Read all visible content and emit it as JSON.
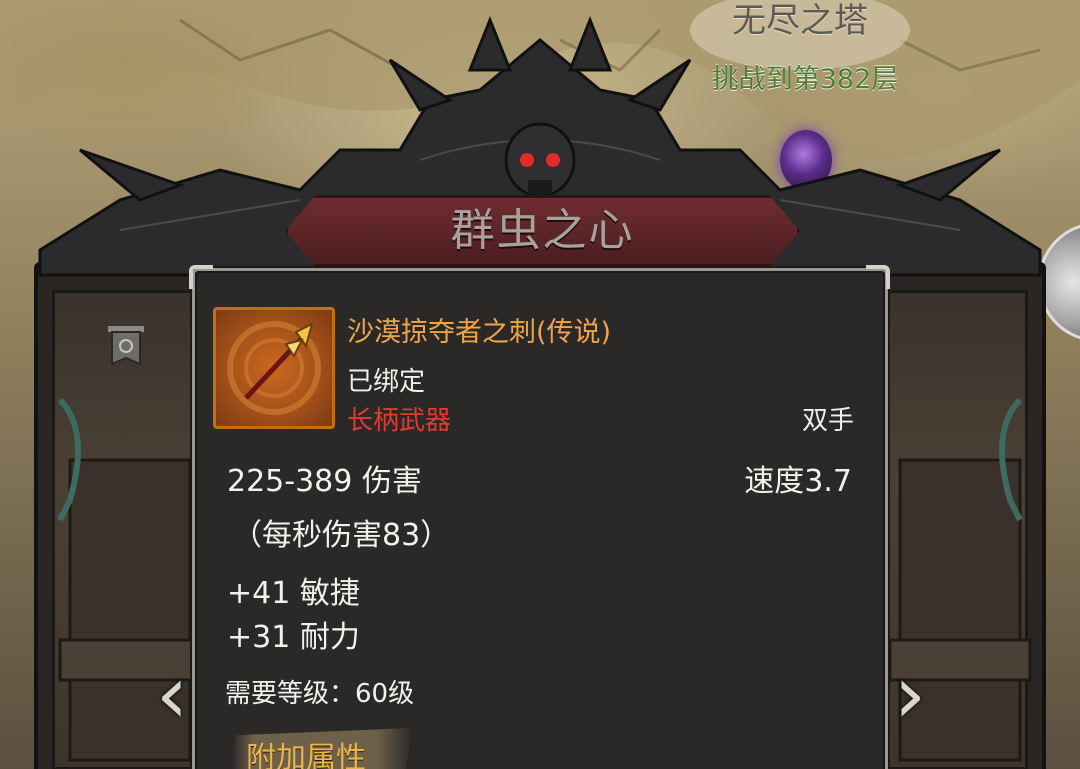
{
  "location": {
    "title": "无尽之塔",
    "subtitle": "挑战到第382层"
  },
  "header": {
    "title": "群虫之心"
  },
  "item": {
    "name": "沙漠掠夺者之刺(传说)",
    "binding": "已绑定",
    "weapon_type": "长柄武器",
    "hand": "双手",
    "damage": "225-389 伤害",
    "speed": "速度3.7",
    "dps": "（每秒伤害83）",
    "stats": [
      "+41 敏捷",
      "+31 耐力"
    ],
    "requirement": "需要等级：60级",
    "extra_section_label": "附加属性",
    "icon": "polearm-weapon-icon"
  },
  "nav": {
    "prev": "‹",
    "next": "›"
  },
  "colors": {
    "legendary": "#f0a44a",
    "weapon_type": "#e23a2e",
    "extra_label": "#e9b64d",
    "subtitle_green": "#4e7d3b",
    "header_plate": "#5e2427"
  }
}
